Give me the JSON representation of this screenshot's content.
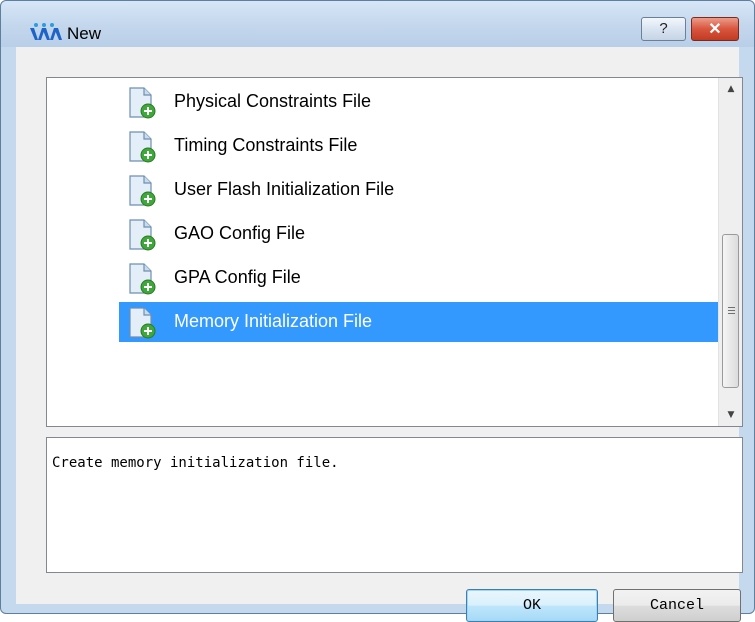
{
  "window": {
    "title": "New",
    "app_icon": "wave-logo-icon"
  },
  "titlebar_buttons": {
    "help_label": "?",
    "close_label": "✕",
    "help_icon": "help-icon",
    "close_icon": "close-icon"
  },
  "file_types": [
    {
      "label": "Physical Constraints File",
      "icon": "new-file-icon",
      "selected": false
    },
    {
      "label": "Timing Constraints File",
      "icon": "new-file-icon",
      "selected": false
    },
    {
      "label": "User Flash Initialization File",
      "icon": "new-file-icon",
      "selected": false
    },
    {
      "label": "GAO Config File",
      "icon": "new-file-icon",
      "selected": false
    },
    {
      "label": "GPA Config File",
      "icon": "new-file-icon",
      "selected": false
    },
    {
      "label": "Memory Initialization File",
      "icon": "new-file-icon",
      "selected": true
    }
  ],
  "scrollbar": {
    "up_icon": "scroll-up-arrow-icon",
    "down_icon": "scroll-down-arrow-icon"
  },
  "description": "Create memory initialization file.",
  "buttons": {
    "ok": "OK",
    "cancel": "Cancel"
  },
  "colors": {
    "selection": "#3399ff",
    "titlebar": "#c3d6ec",
    "close_button": "#c94a33"
  }
}
